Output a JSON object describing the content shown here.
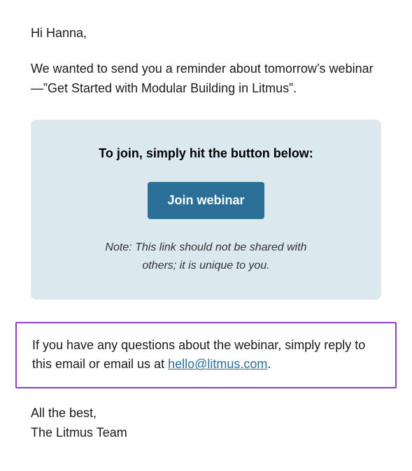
{
  "email": {
    "greeting": "Hi Hanna,",
    "intro": "We wanted to send you a reminder about tomorrow’s webinar—”Get Started with Modular Building in Litmus”.",
    "card": {
      "heading": "To join, simply hit the button below:",
      "button_label": "Join webinar",
      "note": "Note: This link should not be shared with others; it is unique to you."
    },
    "questions": {
      "before_link": "If you have any questions about the webinar, simply reply to this email or email us at ",
      "link_text": "hello@litmus.com",
      "after_link": "."
    },
    "signoff_line1": "All the best,",
    "signoff_line2": "The Litmus Team"
  }
}
